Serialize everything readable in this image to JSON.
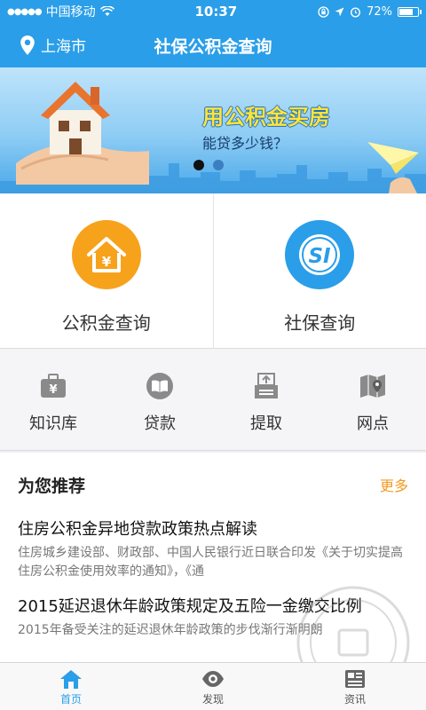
{
  "status_bar": {
    "carrier": "中国移动",
    "time": "10:37",
    "battery": "72%"
  },
  "nav": {
    "location": "上海市",
    "title": "社保公积金查询"
  },
  "banner": {
    "headline": "用公积金买房",
    "subline": "能贷多少钱？",
    "active_slide": 1,
    "slide_count": 2
  },
  "quick_actions": [
    {
      "label": "公积金查询",
      "icon": "house-yuan-icon",
      "color": "#f7a21b"
    },
    {
      "label": "社保查询",
      "icon": "social-security-si-icon",
      "color": "#2a9ee8"
    }
  ],
  "tools": [
    {
      "label": "知识库",
      "icon": "briefcase-yuan-icon"
    },
    {
      "label": "贷款",
      "icon": "book-icon"
    },
    {
      "label": "提取",
      "icon": "withdraw-tray-icon"
    },
    {
      "label": "网点",
      "icon": "map-pin-icon"
    }
  ],
  "recommend": {
    "title": "为您推荐",
    "more": "更多",
    "articles": [
      {
        "title": "住房公积金异地贷款政策热点解读",
        "summary": "住房城乡建设部、财政部、中国人民银行近日联合印发《关于切实提高住房公积金使用效率的通知》，《通"
      },
      {
        "title": "2015延迟退休年龄政策规定及五险一金缴交比例",
        "summary": "2015年备受关注的延迟退休年龄政策的步伐渐行渐明朗"
      }
    ]
  },
  "tabs": [
    {
      "label": "首页",
      "icon": "home-icon"
    },
    {
      "label": "发现",
      "icon": "eye-icon"
    },
    {
      "label": "资讯",
      "icon": "news-icon"
    }
  ],
  "colors": {
    "primary": "#2a9ee8",
    "accent": "#f39a1e",
    "orange_icon": "#f7a21b"
  }
}
